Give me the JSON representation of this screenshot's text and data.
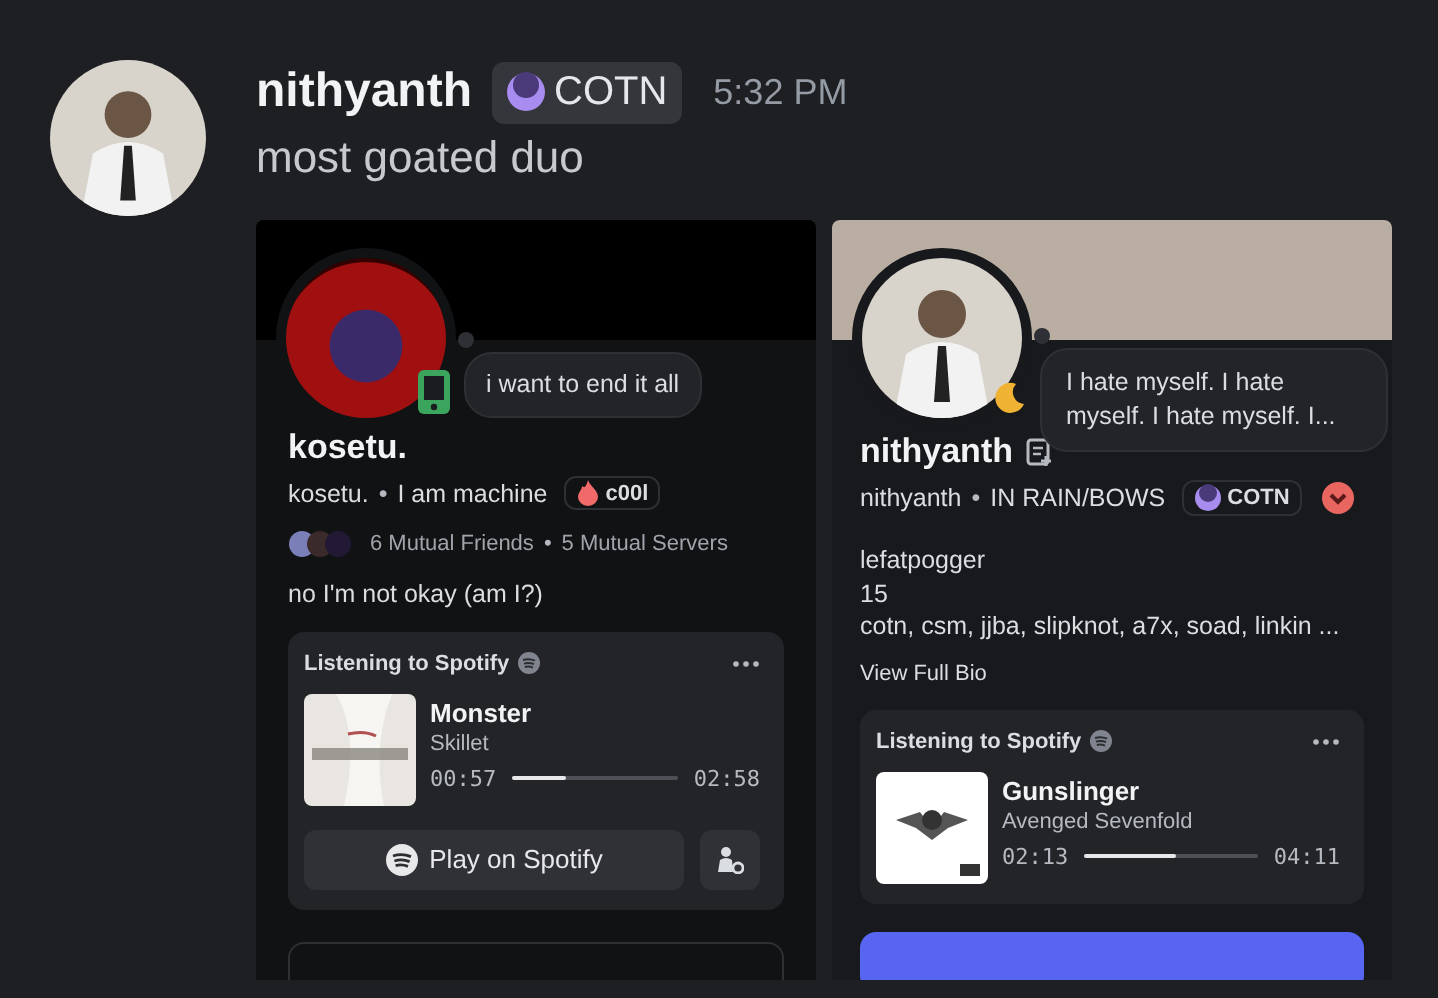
{
  "message": {
    "author": "nithyanth",
    "tag": {
      "label": "COTN"
    },
    "time": "5:32 PM",
    "text": "most goated duo"
  },
  "profiles": [
    {
      "color": "#000000",
      "presence": {
        "kind": "mobile"
      },
      "bubble": "i want to end it all",
      "display_name": "kosetu.",
      "username": "kosetu.",
      "separator": "•",
      "pronouns": "I am machine",
      "tag": {
        "label": "c00l",
        "kind": "flame"
      },
      "mutuals": {
        "friends": "6 Mutual Friends",
        "separator": "•",
        "servers": "5 Mutual Servers"
      },
      "bio": [
        "no I'm not okay (am I?)"
      ],
      "activity": {
        "header": "Listening to Spotify",
        "cover": {
          "kind": "light"
        },
        "title": "Monster",
        "artist": "Skillet",
        "elapsed": "00:57",
        "total": "02:58",
        "level": 0.32,
        "play_button": "Play on Spotify"
      },
      "footer": {
        "kind": "field"
      }
    },
    {
      "color": "#b9aea1",
      "presence": {
        "kind": "idle"
      },
      "bubble": "I hate myself. I hate myself. I hate myself. I...",
      "display_name": "nithyanth",
      "name_note": true,
      "username": "nithyanth",
      "separator": "•",
      "pronouns": "IN RAIN/BOWS",
      "tag": {
        "label": "COTN",
        "kind": "moon"
      },
      "extra_badge": true,
      "bio": [
        "lefatpogger",
        "15",
        "cotn, csm, jjba, slipknot, a7x, soad, linkin ..."
      ],
      "bio_link": "View Full Bio",
      "activity": {
        "header": "Listening to Spotify",
        "cover": {
          "kind": "white"
        },
        "title": "Gunslinger",
        "artist": "Avenged Sevenfold",
        "elapsed": "02:13",
        "total": "04:11",
        "level": 0.53
      },
      "footer": {
        "kind": "button"
      }
    }
  ]
}
